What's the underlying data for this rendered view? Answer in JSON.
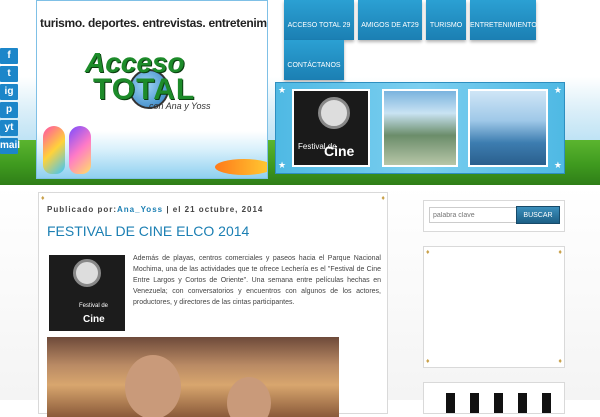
{
  "header": {
    "tagline": "turismo. deportes. entrevistas. entretenimiento",
    "logo_word1": "Acceso",
    "logo_word2": "TOTAL",
    "logo_signature": "con Ana y Yoss"
  },
  "social": [
    "f",
    "t",
    "ig",
    "p",
    "yt",
    "mail"
  ],
  "social_icons": [
    "facebook-icon",
    "twitter-icon",
    "instagram-icon",
    "pinterest-icon",
    "youtube-icon",
    "email-icon"
  ],
  "nav": {
    "items": [
      {
        "label": "ACCESO TOTAL 29"
      },
      {
        "label": "AMIGOS DE AT29"
      },
      {
        "label": "TURISMO"
      },
      {
        "label": "ENTRETENIMIENTO"
      },
      {
        "label": "CONTÁCTANOS"
      }
    ]
  },
  "slider": {
    "poster_title": "Festival de",
    "poster_cine": "Cine"
  },
  "post": {
    "meta_prefix": "Publicado por:",
    "author": "Ana_Yoss",
    "meta_suffix": "| el 21 octubre, 2014",
    "title": "FESTIVAL DE CINE ELCO 2014",
    "thumb_festival": "Festival de",
    "thumb_cine": "Cine",
    "body": "Además de playas, centros comerciales y paseos hacia el Parque Nacional Mochima, una de las actividades que te ofrece Lechería es el \"Festival de Cine Entre Largos y Cortos de Oriente\". Una semana entre películas hechas en Venezuela; con conversatorios y encuentros con algunos de los actores, productores, y directores de las cintas participantes."
  },
  "search": {
    "placeholder": "palabra clave",
    "button_label": "BUSCAR"
  },
  "colors": {
    "accent": "#1b7fb3",
    "nav_bg": "#2ba0d3",
    "grass": "#3f9a1f"
  }
}
